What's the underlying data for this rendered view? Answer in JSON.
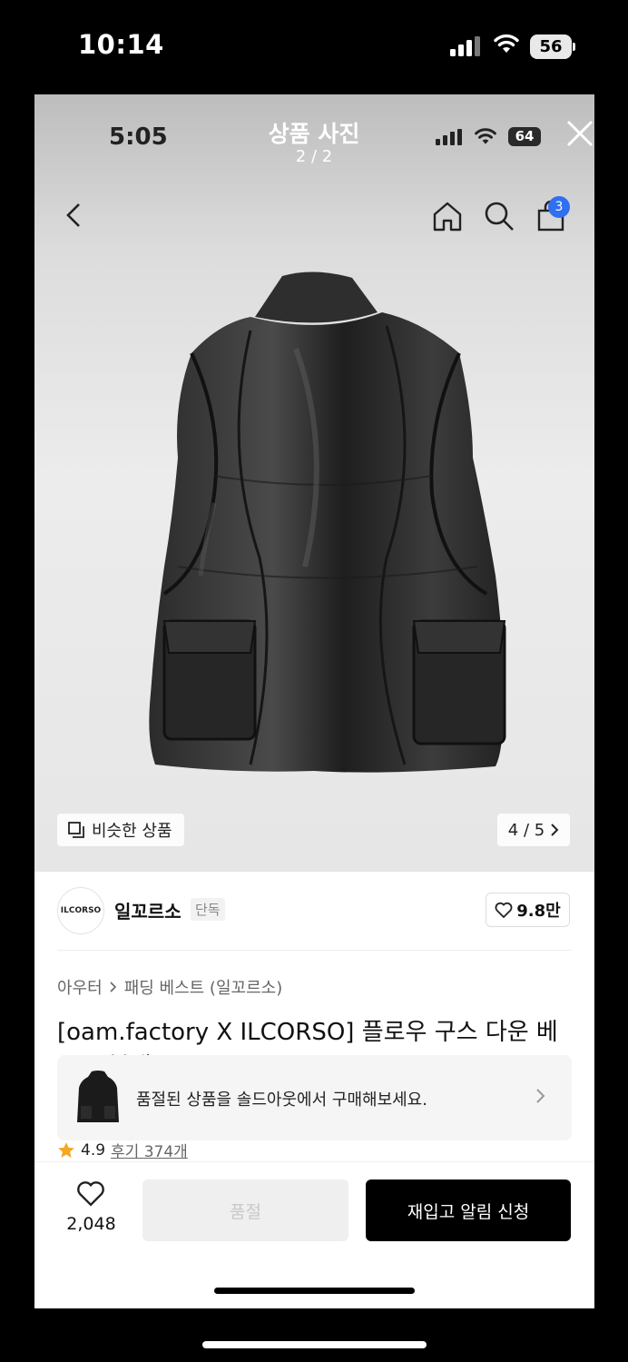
{
  "outer_status": {
    "time": "10:14",
    "battery": "56"
  },
  "inner_status": {
    "time": "5:05",
    "battery": "64"
  },
  "viewer": {
    "title": "상품 사진",
    "count": "2 / 2"
  },
  "nav": {
    "cart_count": "3"
  },
  "image_controls": {
    "similar_label": "비슷한 상품",
    "page_indicator": "4 / 5"
  },
  "brand": {
    "logo_text": "ILCORSO",
    "name": "일꼬르소",
    "tag": "단독",
    "likes": "9.8만"
  },
  "breadcrumb": {
    "level1": "아우터",
    "level2": "패딩 베스트 (일꼬르소)"
  },
  "product": {
    "title": "[oam.factory X ILCORSO] 플로우 구스 다운 베",
    "title_line2": "스트 블랙 IC-IVCF7322BK"
  },
  "banner": {
    "text": "품절된 상품을 솔드아웃에서 구매해보세요."
  },
  "rating": {
    "score": "4.9",
    "reviews": "후기 374개"
  },
  "bottom": {
    "wish_count": "2,048",
    "soldout_label": "품절",
    "restock_label": "재입고 알림 신청"
  },
  "colors": {
    "accent_badge": "#2f6ff0",
    "cta": "#000000",
    "star": "#f5a623"
  },
  "icons": [
    "signal-icon",
    "wifi-icon",
    "battery-icon",
    "close-icon",
    "back-icon",
    "home-icon",
    "search-icon",
    "cart-icon",
    "similar-icon",
    "chevron-right-icon",
    "heart-icon",
    "star-icon"
  ]
}
